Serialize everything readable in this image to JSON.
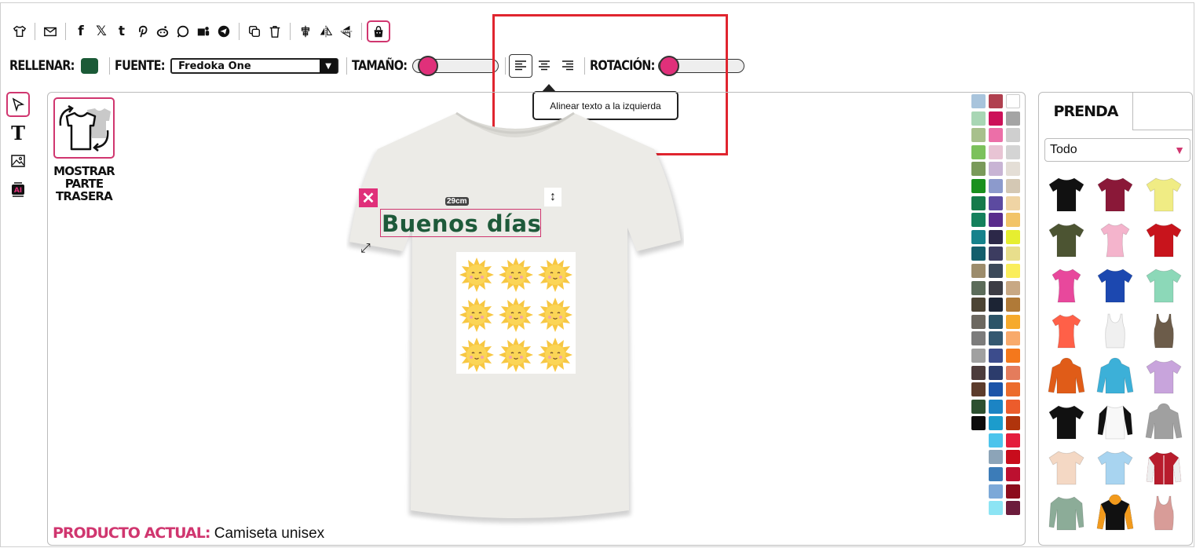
{
  "toolbar": {
    "icons": [
      "tshirt-icon",
      "mail-icon",
      "facebook-icon",
      "x-icon",
      "tumblr-icon",
      "pinterest-icon",
      "reddit-icon",
      "whatsapp-icon",
      "teams-icon",
      "telegram-icon",
      "copy-icon",
      "trash-icon",
      "align-center-vertical-icon",
      "flip-horizontal-icon",
      "flip-vertical-icon",
      "bag-icon"
    ]
  },
  "format": {
    "fill_label": "RELLENAR:",
    "fill_color": "#1b5a37",
    "font_label": "FUENTE:",
    "font_value": "Fredoka One",
    "size_label": "TAMAÑO:",
    "size_value": 0.1,
    "rotation_label": "ROTACIÓN:",
    "rotation_value": 0.02
  },
  "tooltip": {
    "text": "Alinear texto a la izquierda"
  },
  "left_rail": [
    "select-tool-icon",
    "text-tool-icon",
    "image-tool-icon",
    "ai-tool-icon"
  ],
  "canvas": {
    "show_back_label_1": "MOSTRAR",
    "show_back_label_2": "PARTE",
    "show_back_label_3": "TRASERA",
    "design_text": "Buenos días",
    "design_size": "29cm",
    "current_product_label": "PRODUCTO ACTUAL:",
    "current_product_value": "Camiseta unisex",
    "colors": [
      "#a8c4dc",
      "#b0404f",
      "#ffffff",
      "#a8d6b4",
      "#cc1159",
      "#a4a4a4",
      "#a8c08c",
      "#ec6fa8",
      "#cfcfcf",
      "#7cc15c",
      "#e8c4d4",
      "#d4d4d4",
      "#7a9a5a",
      "#c8b4d4",
      "#e4ded6",
      "#19901e",
      "#8c9acc",
      "#d4c8b4",
      "#157a4a",
      "#5c4aa0",
      "#efd4a4",
      "#14805c",
      "#5a2c8c",
      "#f2c468",
      "#16828c",
      "#2c2848",
      "#e6ee30",
      "#145e6c",
      "#3c3c60",
      "#e8de8c",
      "#9c8c6c",
      "#3c4a5a",
      "#faee5c",
      "#5c6c5a",
      "#3c3c44",
      "#c8a884",
      "#4c4434",
      "#1c2434",
      "#b07a38",
      "#6c6860",
      "#2c5468",
      "#f6aa2c",
      "#7c7c7c",
      "#345870",
      "#f8aa6c",
      "#a0a0a0",
      "#3c4c8c",
      "#f4781c",
      "#4c3c3c",
      "#2c3c6c",
      "#e47c5c",
      "#5c3c2c",
      "#1c54a8",
      "#ec6c2c",
      "#2c5030",
      "#1c84c4",
      "#ec5c2c",
      "#0c0c0c",
      "#1c9ccc",
      "#b0340c",
      null,
      "#4cc4ec",
      "#e41c3c",
      null,
      "#8ca4b8",
      "#c80c1c",
      null,
      "#3c7cb8",
      "#bc1030",
      null,
      "#7ca8d8",
      "#8c0c1c",
      null,
      "#8ce4f4",
      "#6c1c3c"
    ]
  },
  "panel": {
    "tab_label": "PRENDA",
    "filter_value": "Todo",
    "products": [
      {
        "color": "#111111",
        "kind": "tee"
      },
      {
        "color": "#8a1838",
        "kind": "tee"
      },
      {
        "color": "#f0ec84",
        "kind": "tee"
      },
      {
        "color": "#4c5432",
        "kind": "tee"
      },
      {
        "color": "#f4b4cc",
        "kind": "tee-women"
      },
      {
        "color": "#c8141c",
        "kind": "tee"
      },
      {
        "color": "#e8489c",
        "kind": "tee-women"
      },
      {
        "color": "#1c48b0",
        "kind": "tee"
      },
      {
        "color": "#8cd8b8",
        "kind": "tee"
      },
      {
        "color": "#ff6048",
        "kind": "tee-women"
      },
      {
        "color": "#f0f0f0",
        "kind": "tank"
      },
      {
        "color": "#6c5c4a",
        "kind": "tank"
      },
      {
        "color": "#e05c18",
        "kind": "hoodie"
      },
      {
        "color": "#3cb0d8",
        "kind": "hoodie"
      },
      {
        "color": "#c8a4dc",
        "kind": "tee"
      },
      {
        "color": "#111111",
        "kind": "tee"
      },
      {
        "color": "#f8f8f8",
        "kind": "raglan"
      },
      {
        "color": "#a0a0a0",
        "kind": "hoodie"
      },
      {
        "color": "#f4d8c4",
        "kind": "tee"
      },
      {
        "color": "#a8d4f0",
        "kind": "tee"
      },
      {
        "color": "#b81c2c",
        "kind": "jacket"
      },
      {
        "color": "#8cac98",
        "kind": "longsleeve"
      },
      {
        "color": "#111111",
        "kind": "hoodie-orange"
      },
      {
        "color": "#d89c98",
        "kind": "tank"
      }
    ]
  }
}
